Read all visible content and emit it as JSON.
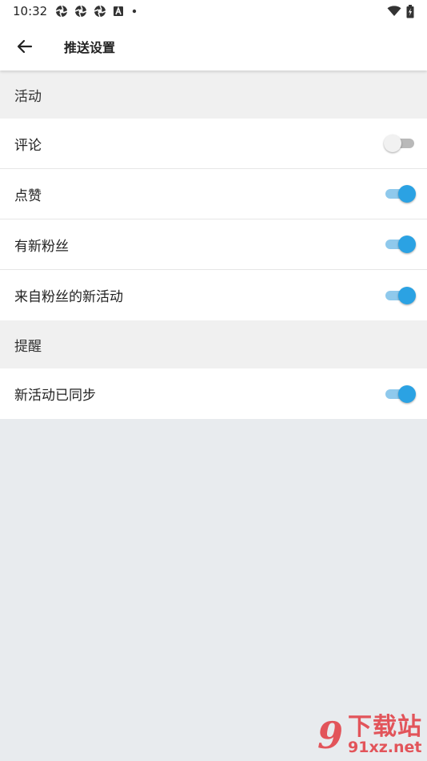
{
  "status_bar": {
    "time": "10:32",
    "notification_icons": [
      "aperture-icon",
      "aperture-icon",
      "aperture-icon",
      "a-box-icon",
      "dot-icon"
    ],
    "right_icons": [
      "wifi-icon",
      "battery-icon"
    ]
  },
  "app_bar": {
    "back_icon": "arrow-left-icon",
    "title": "推送设置"
  },
  "sections": [
    {
      "title": "活动",
      "items": [
        {
          "label": "评论",
          "enabled": false
        },
        {
          "label": "点赞",
          "enabled": true
        },
        {
          "label": "有新粉丝",
          "enabled": true
        },
        {
          "label": "来自粉丝的新活动",
          "enabled": true
        }
      ]
    },
    {
      "title": "提醒",
      "items": [
        {
          "label": "新活动已同步",
          "enabled": true
        }
      ]
    }
  ],
  "watermark": {
    "logo": "9",
    "text": "下载站",
    "url": "91xz.net"
  },
  "colors": {
    "accent": "#2ba2e3",
    "accent_track": "#8fc9ec",
    "section_bg": "#f0f0f0",
    "page_bg": "#e8ebee",
    "watermark": "#e2545a"
  }
}
